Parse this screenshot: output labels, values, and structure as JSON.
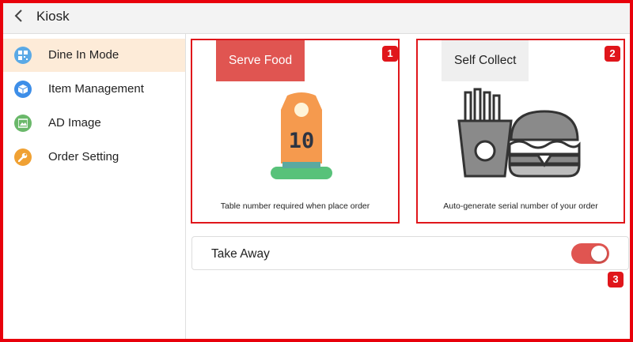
{
  "header": {
    "title": "Kiosk",
    "back_icon": "chevron-left-icon"
  },
  "sidebar": {
    "items": [
      {
        "label": "Dine In Mode",
        "icon": "qr-code-icon",
        "color": "#5aa9e6",
        "active": true
      },
      {
        "label": "Item Management",
        "icon": "cube-icon",
        "color": "#3d8ee8",
        "active": false
      },
      {
        "label": "AD Image",
        "icon": "image-icon",
        "color": "#6ab86a",
        "active": false
      },
      {
        "label": "Order Setting",
        "icon": "wrench-icon",
        "color": "#f0a133",
        "active": false
      }
    ]
  },
  "main": {
    "cards": [
      {
        "tag": "Serve Food",
        "description": "Table number required when place order",
        "badge": "1",
        "illustration": "table-number-stand-icon",
        "number": "10",
        "selected": true
      },
      {
        "tag": "Self Collect",
        "description": "Auto-generate serial number of your order",
        "badge": "2",
        "illustration": "fries-burger-icon",
        "selected": false
      }
    ],
    "takeaway": {
      "label": "Take Away",
      "enabled": true,
      "badge": "3"
    }
  },
  "colors": {
    "accent": "#e05551",
    "highlight": "#e0161b",
    "active_bg": "#fdebd8"
  }
}
